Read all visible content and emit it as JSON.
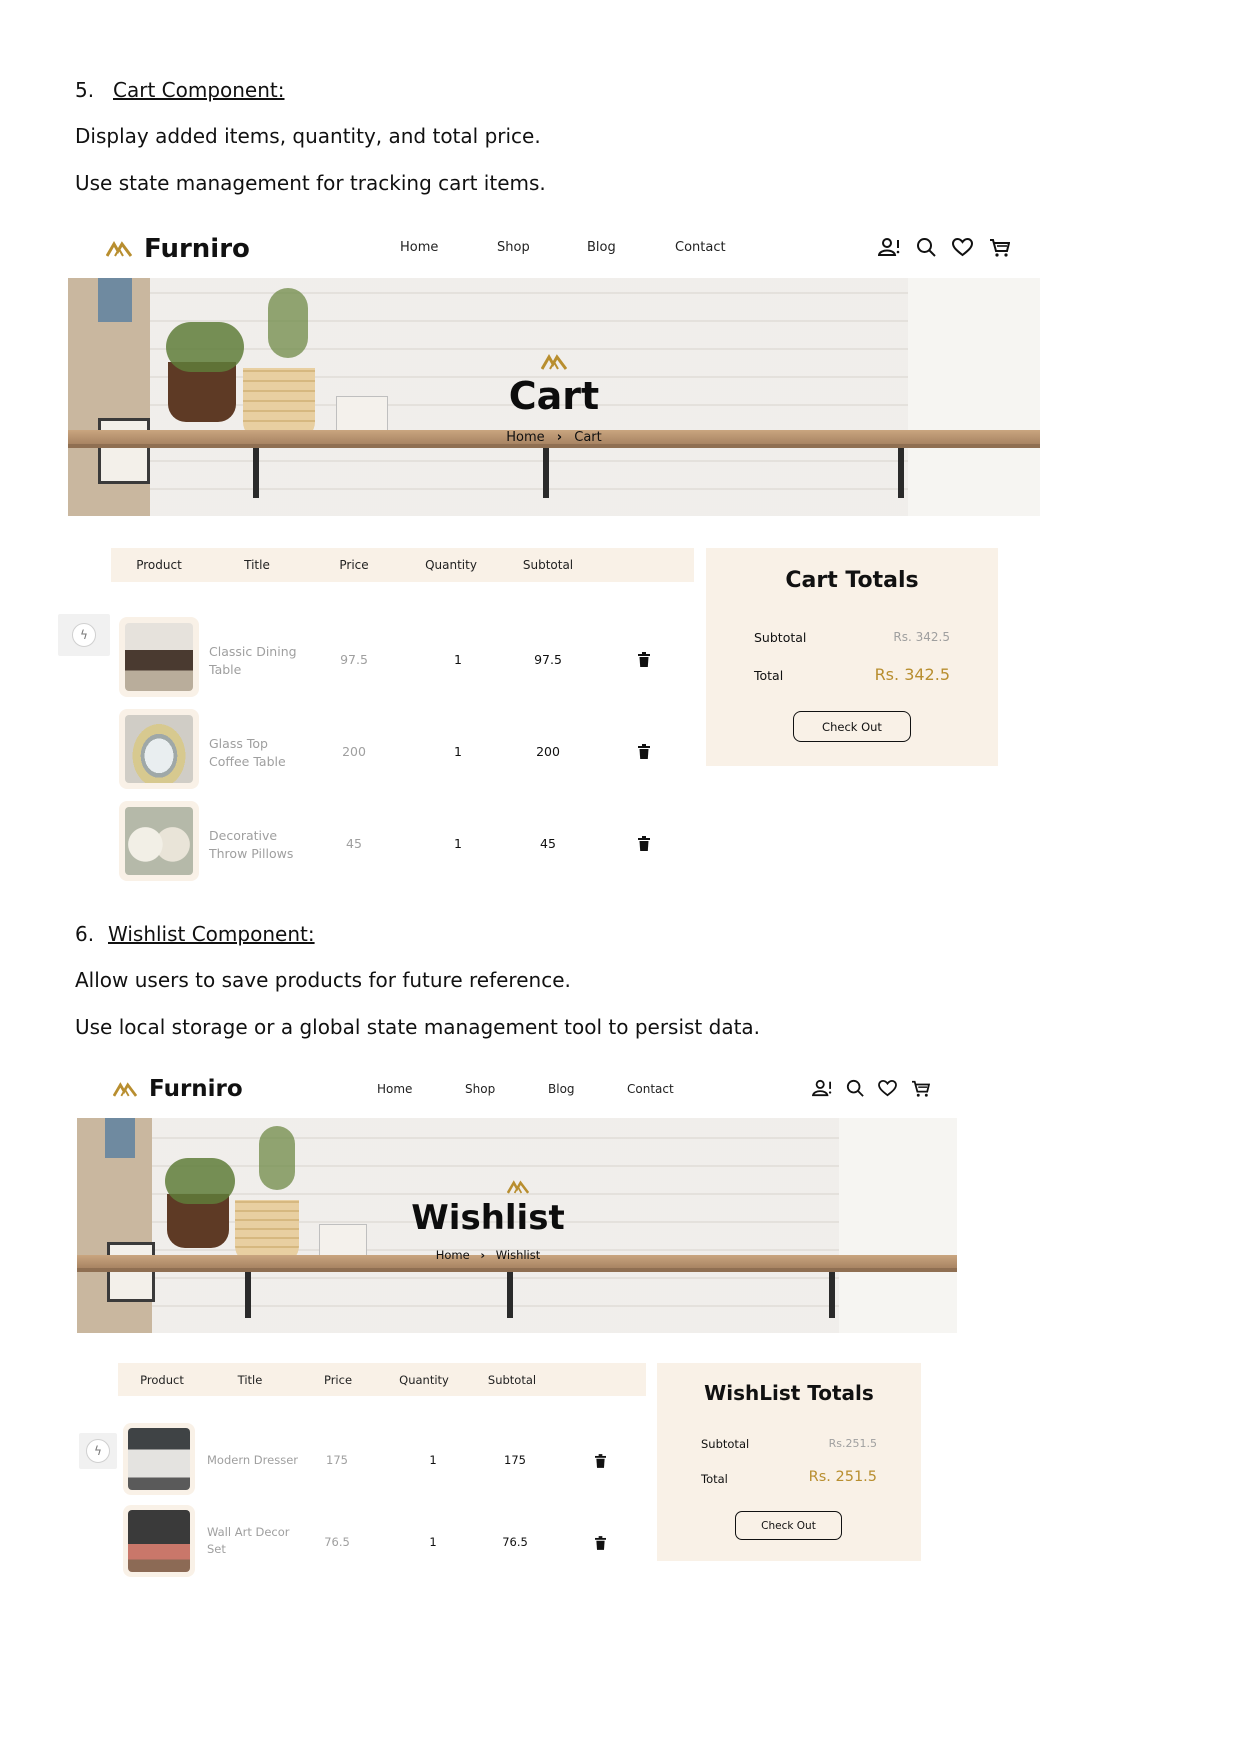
{
  "sections": [
    {
      "number": "5.",
      "title": "Cart Component:",
      "lines": [
        "Display added items, quantity, and total price.",
        "Use state management for tracking cart items."
      ]
    },
    {
      "number": "6.",
      "title": "Wishlist Component:",
      "lines": [
        "Allow users to save products for future reference.",
        "Use local storage or a global state management tool to persist data."
      ]
    }
  ],
  "brand": {
    "name": "Furniro",
    "accent_color": "#b88e2f",
    "panel_color": "#f9f1e7"
  },
  "nav": {
    "links": [
      "Home",
      "Shop",
      "Blog",
      "Contact"
    ],
    "icons": [
      "user-alert-icon",
      "search-icon",
      "heart-icon",
      "cart-icon"
    ]
  },
  "cart": {
    "hero_title": "Cart",
    "breadcrumb": [
      "Home",
      "Cart"
    ],
    "columns": [
      "Product",
      "Title",
      "Price",
      "Quantity",
      "Subtotal"
    ],
    "items": [
      {
        "title_line1": "Classic Dining",
        "title_line2": "Table",
        "price": "97.5",
        "quantity": "1",
        "subtotal": "97.5"
      },
      {
        "title_line1": "Glass Top",
        "title_line2": "Coffee Table",
        "price": "200",
        "quantity": "1",
        "subtotal": "200"
      },
      {
        "title_line1": "Decorative",
        "title_line2": "Throw Pillows",
        "price": "45",
        "quantity": "1",
        "subtotal": "45"
      }
    ],
    "totals": {
      "title": "Cart Totals",
      "subtotal_label": "Subtotal",
      "subtotal_value": "Rs. 342.5",
      "total_label": "Total",
      "total_value": "Rs. 342.5",
      "button": "Check Out"
    }
  },
  "wishlist": {
    "hero_title": "Wishlist",
    "breadcrumb": [
      "Home",
      "Wishlist"
    ],
    "columns": [
      "Product",
      "Title",
      "Price",
      "Quantity",
      "Subtotal"
    ],
    "items": [
      {
        "title_line1": "Modern Dresser",
        "title_line2": "",
        "price": "175",
        "quantity": "1",
        "subtotal": "175"
      },
      {
        "title_line1": "Wall Art Decor",
        "title_line2": "Set",
        "price": "76.5",
        "quantity": "1",
        "subtotal": "76.5"
      }
    ],
    "totals": {
      "title": "WishList Totals",
      "subtotal_label": "Subtotal",
      "subtotal_value": "Rs.251.5",
      "total_label": "Total",
      "total_value": "Rs. 251.5",
      "button": "Check Out"
    }
  }
}
